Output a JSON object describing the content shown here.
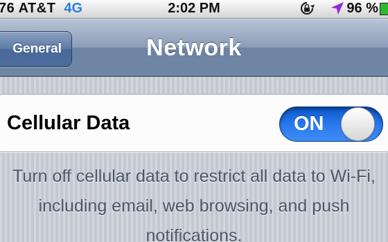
{
  "status_bar": {
    "signal_prefix": "76",
    "carrier": "AT&T",
    "network_type": "4G",
    "time": "2:02 PM",
    "battery_percent": "96 %",
    "icons": [
      "rotation-lock-icon",
      "location-arrow-icon",
      "battery-icon"
    ],
    "colors": {
      "network_type": "#2b7fd8",
      "location_arrow": "#8a2be2",
      "battery_fill": "#2dbb2d"
    }
  },
  "nav_bar": {
    "back_label": "General",
    "title": "Network"
  },
  "cellular": {
    "label": "Cellular Data",
    "toggle_state": "ON",
    "toggle_color": "#2b7af0"
  },
  "footer": {
    "note": "Turn off cellular data to restrict all data to Wi-Fi, including email, web browsing, and push notifications."
  }
}
